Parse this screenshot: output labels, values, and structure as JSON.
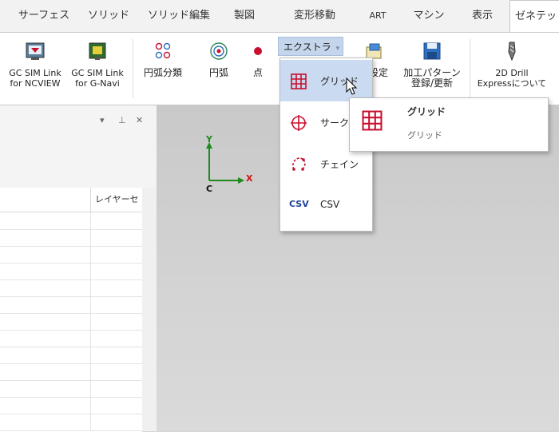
{
  "tabs": [
    {
      "label": "サーフェス"
    },
    {
      "label": "ソリッド"
    },
    {
      "label": "ソリッド編集"
    },
    {
      "label": "製図"
    },
    {
      "label": "変形移動"
    },
    {
      "label": "ART"
    },
    {
      "label": "マシン"
    },
    {
      "label": "表示"
    },
    {
      "label": "ゼネテッ"
    }
  ],
  "ribbon": {
    "gc_sim_ncview": {
      "line1": "GC SIM Link",
      "line2": "for NCVIEW"
    },
    "gc_sim_gnavi": {
      "line1": "GC SIM Link",
      "line2": "for G-Navi"
    },
    "arc_classify": "円弧分類",
    "arc": "円弧",
    "point": "点",
    "extra": "エクストラ",
    "settings": "設定",
    "pattern": {
      "line1": "加工パターン",
      "line2": "登録/更新"
    },
    "about": {
      "line1": "2D Drill",
      "line2": "Expressについて"
    }
  },
  "panel": {
    "col_header": "レイヤーセ",
    "buttons": {
      "menu": "▾",
      "pin": "⊥",
      "close": "✕"
    }
  },
  "canvas": {
    "axis_x": "X",
    "axis_y": "Y",
    "axis_c": "C"
  },
  "dropdown": {
    "items": [
      {
        "label": "グリッド",
        "icon": "grid-icon"
      },
      {
        "label": "サーク",
        "icon": "circle-target-icon"
      },
      {
        "label": "チェイン",
        "icon": "chain-icon"
      },
      {
        "label": "CSV",
        "icon": "csv-icon",
        "icon_text": "CSV"
      }
    ]
  },
  "tooltip": {
    "title": "グリッド",
    "description": "グリッド"
  },
  "colors": {
    "accent": "#c9daf1",
    "icon_red": "#c8102e",
    "axis_green": "#1e8a1e",
    "axis_red": "#d01010"
  }
}
